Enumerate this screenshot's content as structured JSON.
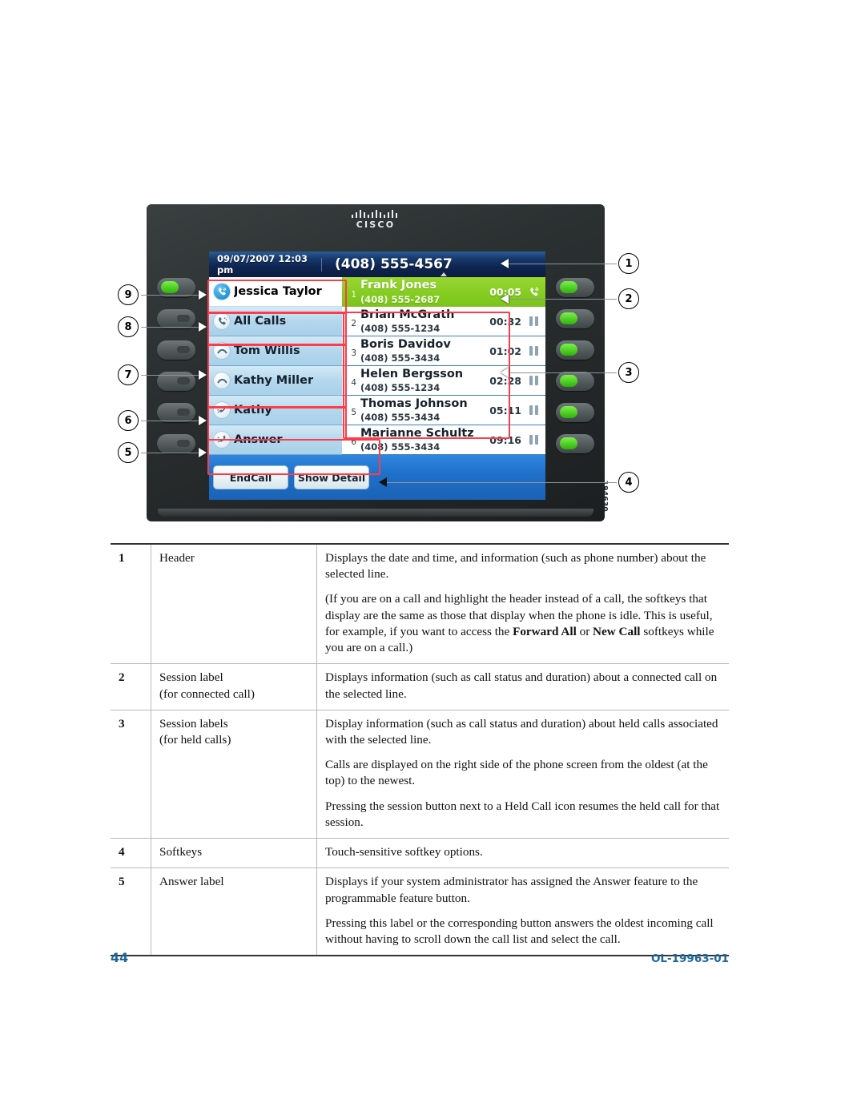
{
  "figure": {
    "brand": "CISCO",
    "figure_id": "194630",
    "screen": {
      "header": {
        "datetime": "09/07/2007 12:03 pm",
        "phone_number": "(408) 555-4567"
      },
      "line_labels": [
        {
          "label": "Jessica Taylor",
          "icon": "active-line-handset-icon",
          "selected": true
        },
        {
          "label": "All Calls",
          "icon": "all-calls-handset-icon",
          "selected": false
        },
        {
          "label": "Tom Willis",
          "icon": "on-hook-arc-icon",
          "selected": false
        },
        {
          "label": "Kathy Miller",
          "icon": "on-hook-arc-icon",
          "selected": false
        },
        {
          "label": "Kathy",
          "icon": "ringing-handset-icon",
          "selected": false
        },
        {
          "label": "Answer",
          "icon": "ringing-handset-icon",
          "selected": false
        }
      ],
      "calls": [
        {
          "index": "1",
          "name": "Frank Jones",
          "number": "(408) 555-2687",
          "duration": "00:05",
          "state": "connected",
          "status_icon": "connected-handset-icon"
        },
        {
          "index": "2",
          "name": "Brian McGrath",
          "number": "(408) 555-1234",
          "duration": "00:32",
          "state": "held",
          "status_icon": "hold-pause-icon"
        },
        {
          "index": "3",
          "name": "Boris Davidov",
          "number": "(408) 555-3434",
          "duration": "01:02",
          "state": "held",
          "status_icon": "hold-pause-icon"
        },
        {
          "index": "4",
          "name": "Helen Bergsson",
          "number": "(408) 555-1234",
          "duration": "02:28",
          "state": "held",
          "status_icon": "hold-pause-icon"
        },
        {
          "index": "5",
          "name": "Thomas Johnson",
          "number": "(408) 555-3434",
          "duration": "05:11",
          "state": "held",
          "status_icon": "hold-pause-icon"
        },
        {
          "index": "6",
          "name": "Marianne Schultz",
          "number": "(408) 555-3434",
          "duration": "09:16",
          "state": "held",
          "status_icon": "hold-pause-icon"
        }
      ],
      "softkeys": [
        {
          "label": "EndCall"
        },
        {
          "label": "Show Detail"
        }
      ]
    },
    "callouts": {
      "right": [
        "1",
        "2",
        "3",
        "4"
      ],
      "left": [
        "9",
        "8",
        "7",
        "6",
        "5"
      ]
    }
  },
  "table": {
    "rows": [
      {
        "num": "1",
        "term": "Header",
        "paragraphs": [
          "Displays the date and time, and information (such as phone number) about the selected line.",
          "(If you are on a call and highlight the header instead of a call, the softkeys that display are the same as those that display when the phone is idle. This is useful, for example, if you want to access the Forward All or New Call softkeys while you are on a call.)"
        ]
      },
      {
        "num": "2",
        "term": "Session label\n(for connected call)",
        "term_line1": "Session label",
        "term_line2": "(for connected call)",
        "paragraphs": [
          "Displays information (such as call status and duration) about a connected call on the selected line."
        ]
      },
      {
        "num": "3",
        "term_line1": "Session labels",
        "term_line2": "(for held calls)",
        "paragraphs": [
          "Display information (such as call status and duration) about held calls associated with the selected line.",
          "Calls are displayed on the right side of the phone screen from the oldest (at the top) to the newest.",
          "Pressing the session button next to a Held Call icon resumes the held call for that session."
        ]
      },
      {
        "num": "4",
        "term_line1": "Softkeys",
        "term_line2": "",
        "paragraphs": [
          "Touch-sensitive softkey options."
        ]
      },
      {
        "num": "5",
        "term_line1": "Answer label",
        "term_line2": "",
        "paragraphs": [
          "Displays if your system administrator has assigned the Answer feature to the programmable feature button.",
          "Pressing this label or the corresponding button answers the oldest incoming call without having to scroll down the call list and select the call."
        ]
      }
    ],
    "row1_p2_prefix": "(If you are on a call and highlight the header instead of a call, the softkeys that display are the same as those that display when the phone is idle. This is useful, for example, if you want to access the ",
    "row1_bold1": "Forward All",
    "row1_mid": " or ",
    "row1_bold2": "New Call",
    "row1_p2_suffix": " softkeys while you are on a call.)"
  },
  "footer": {
    "page_number": "44",
    "document_id": "OL-19963-01"
  },
  "colors": {
    "accent_blue": "#1f6699",
    "connected_green": "#8acd24",
    "highlight_red": "#ff3b4a",
    "header_navy": "#0e2450",
    "softkey_bar_blue": "#1f6fc8"
  }
}
